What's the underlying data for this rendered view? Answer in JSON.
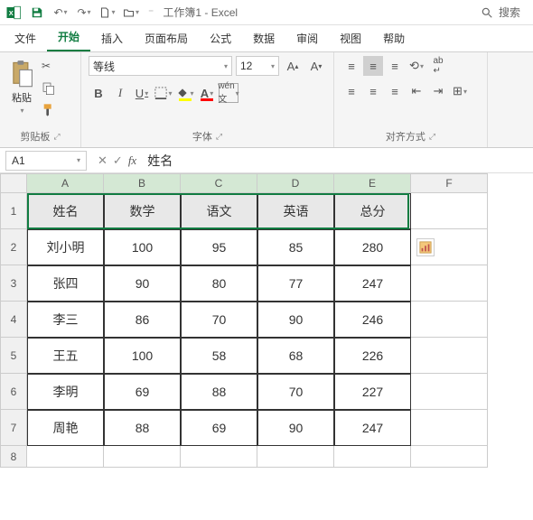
{
  "title": {
    "doc": "工作簿1",
    "app": "Excel"
  },
  "search": {
    "placeholder": "搜索"
  },
  "tabs": [
    "文件",
    "开始",
    "插入",
    "页面布局",
    "公式",
    "数据",
    "审阅",
    "视图",
    "帮助"
  ],
  "active_tab": 1,
  "ribbon": {
    "clipboard": {
      "paste": "粘贴",
      "label": "剪贴板"
    },
    "font": {
      "name": "等线",
      "size": "12",
      "label": "字体"
    },
    "align": {
      "label": "对齐方式"
    }
  },
  "namebox": "A1",
  "formula_value": "姓名",
  "columns": [
    "A",
    "B",
    "C",
    "D",
    "E",
    "F"
  ],
  "rows": [
    "1",
    "2",
    "3",
    "4",
    "5",
    "6",
    "7",
    "8"
  ],
  "table": {
    "headers": [
      "姓名",
      "数学",
      "语文",
      "英语",
      "总分"
    ],
    "data": [
      [
        "刘小明",
        "100",
        "95",
        "85",
        "280"
      ],
      [
        "张四",
        "90",
        "80",
        "77",
        "247"
      ],
      [
        "李三",
        "86",
        "70",
        "90",
        "246"
      ],
      [
        "王五",
        "100",
        "58",
        "68",
        "226"
      ],
      [
        "李明",
        "69",
        "88",
        "70",
        "227"
      ],
      [
        "周艳",
        "88",
        "69",
        "90",
        "247"
      ]
    ]
  },
  "chart_data": {
    "type": "table",
    "headers": [
      "姓名",
      "数学",
      "语文",
      "英语",
      "总分"
    ],
    "rows": [
      {
        "姓名": "刘小明",
        "数学": 100,
        "语文": 95,
        "英语": 85,
        "总分": 280
      },
      {
        "姓名": "张四",
        "数学": 90,
        "语文": 80,
        "英语": 77,
        "总分": 247
      },
      {
        "姓名": "李三",
        "数学": 86,
        "语文": 70,
        "英语": 90,
        "总分": 246
      },
      {
        "姓名": "王五",
        "数学": 100,
        "语文": 58,
        "英语": 68,
        "总分": 226
      },
      {
        "姓名": "李明",
        "数学": 69,
        "语文": 88,
        "英语": 70,
        "总分": 227
      },
      {
        "姓名": "周艳",
        "数学": 88,
        "语文": 69,
        "英语": 90,
        "总分": 247
      }
    ]
  }
}
